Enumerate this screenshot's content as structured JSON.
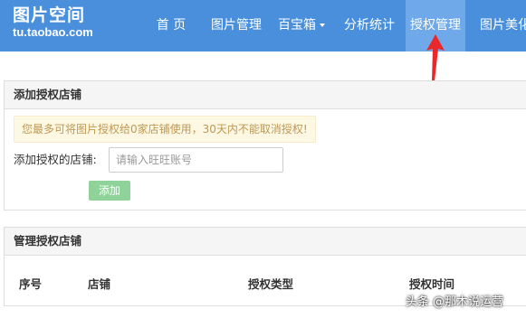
{
  "header": {
    "logo_main": "图片空间",
    "logo_sub": "tu.taobao.com",
    "nav": [
      {
        "label": "首 页"
      },
      {
        "label": "图片管理"
      },
      {
        "label": "百宝箱"
      },
      {
        "label": "分析统计"
      },
      {
        "label": "授权管理",
        "active": true
      },
      {
        "label": "图片美化"
      }
    ]
  },
  "add_panel": {
    "title": "添加授权店铺",
    "notice": "您最多可将图片授权给0家店铺使用，30天内不能取消授权!",
    "shop_label": "添加授权的店铺:",
    "shop_placeholder": "请输入旺旺账号",
    "add_button": "添加"
  },
  "manage_panel": {
    "title": "管理授权店铺",
    "columns": [
      "序号",
      "店铺",
      "授权类型",
      "授权时间"
    ]
  },
  "watermark": "头条 @那木说运营",
  "colors": {
    "header_bg": "#4a8fdc",
    "nav_active_bg": "#6fa9e9",
    "notice_bg": "#fcf8e3",
    "notice_text": "#c09853",
    "button_bg": "#8fd39a",
    "annotation_arrow": "#e8282b"
  }
}
